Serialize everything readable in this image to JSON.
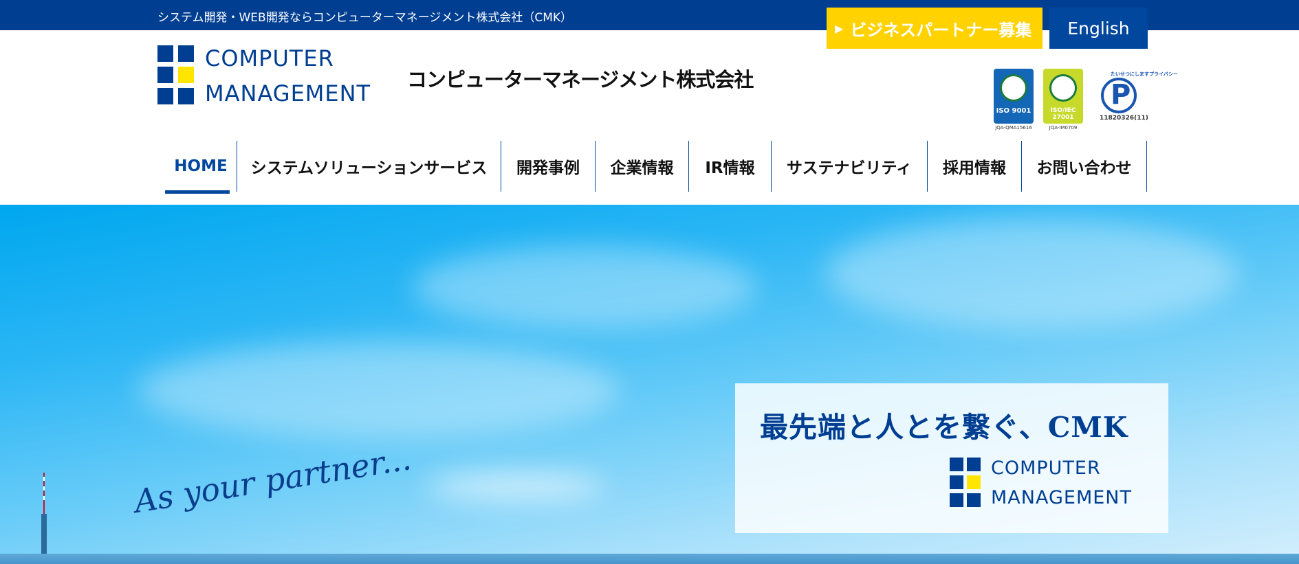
{
  "topbar": {
    "tagline": "システム開発・WEB開発ならコンピューターマネージメント株式会社（CMK）",
    "partner_label": "ビジネスパートナー募集",
    "partner_icon": "triangle-right-icon",
    "english_label": "English"
  },
  "logo": {
    "line1": "COMPUTER",
    "line2": "MANAGEMENT",
    "company_jp": "コンピューターマネージメント株式会社"
  },
  "certs": [
    {
      "label": "ISO 9001",
      "sub": "JQA-QMA15616"
    },
    {
      "label": "ISO/IEC 27001",
      "sub": "JQA-IM0709"
    }
  ],
  "privacy_mark": {
    "top": "たいせつにしますプライバシー",
    "number": "11820326(11)"
  },
  "nav": [
    {
      "label": "HOME",
      "active": true
    },
    {
      "label": "システムソリューションサービス",
      "active": false
    },
    {
      "label": "開発事例",
      "active": false
    },
    {
      "label": "企業情報",
      "active": false
    },
    {
      "label": "IR情報",
      "active": false
    },
    {
      "label": "サステナビリティ",
      "active": false
    },
    {
      "label": "採用情報",
      "active": false
    },
    {
      "label": "お問い合わせ",
      "active": false
    }
  ],
  "hero": {
    "script_tagline": "As your partner...",
    "headline": "最先端と人とを繋ぐ、CMK",
    "logo_line1": "COMPUTER",
    "logo_line2": "MANAGEMENT"
  },
  "colors": {
    "brand_blue": "#003e92",
    "accent_yellow": "#ffd200",
    "nav_blue": "#00479d"
  }
}
